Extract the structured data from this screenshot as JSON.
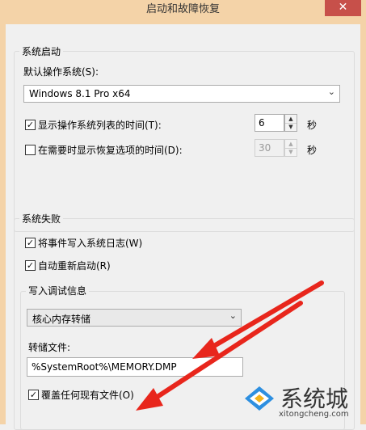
{
  "window": {
    "title": "启动和故障恢复",
    "close_glyph": "✕"
  },
  "startup": {
    "group_label": "系统启动",
    "default_os_label": "默认操作系统(S):",
    "default_os_value": "Windows 8.1 Pro x64",
    "show_list": {
      "label": "显示操作系统列表的时间(T):",
      "checked": true,
      "value": "6",
      "unit": "秒"
    },
    "show_recovery": {
      "label": "在需要时显示恢复选项的时间(D):",
      "checked": false,
      "value": "30",
      "unit": "秒"
    }
  },
  "failure": {
    "group_label": "系统失败",
    "write_event": {
      "label": "将事件写入系统日志(W)",
      "checked": true
    },
    "auto_restart": {
      "label": "自动重新启动(R)",
      "checked": true
    },
    "debug": {
      "group_label": "写入调试信息",
      "type_value": "核心内存转储",
      "dump_file_label": "转储文件:",
      "dump_file_value": "%SystemRoot%\\MEMORY.DMP",
      "overwrite": {
        "label": "覆盖任何现有文件(O)",
        "checked": true
      }
    }
  },
  "annotations": {
    "arrow_color": "#e8261c"
  },
  "watermark": {
    "brand": "系统城",
    "url": "xitongcheng.com"
  },
  "icons": {
    "check": "✓",
    "dropdown": "⌄",
    "spin_up": "▲",
    "spin_down": "▼"
  }
}
